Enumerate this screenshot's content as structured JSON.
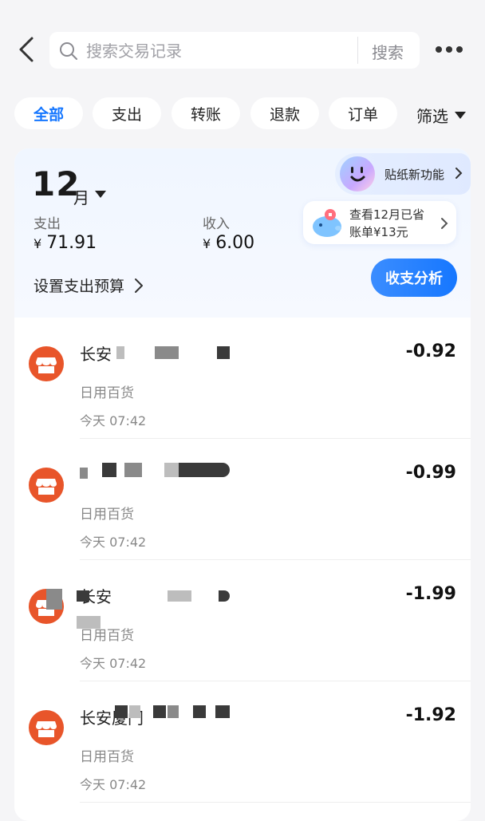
{
  "search": {
    "placeholder": "搜索交易记录",
    "button_label": "搜索"
  },
  "filters": {
    "chips": [
      "全部",
      "支出",
      "转账",
      "退款",
      "订单"
    ],
    "active": "全部",
    "dropdown_label": "筛选"
  },
  "summary": {
    "month": "12",
    "month_unit": "月",
    "expense_label": "支出",
    "expense_currency": "¥",
    "expense_value": "71.91",
    "income_label": "收入",
    "income_currency": "¥",
    "income_value": "6.00",
    "budget_label": "设置支出预算",
    "sticker_label": "贴纸新功能",
    "saved_line1": "查看12月已省",
    "saved_line2": "账单¥13元",
    "analysis_button": "收支分析"
  },
  "transactions": [
    {
      "name": "长安",
      "category": "日用百货",
      "time": "今天 07:42",
      "amount": "-0.92"
    },
    {
      "name": "",
      "category": "日用百货",
      "time": "今天 07:42",
      "amount": "-0.99"
    },
    {
      "name": "长安",
      "category": "日用百货",
      "time": "今天 07:42",
      "amount": "-1.99"
    },
    {
      "name": "长安厦门",
      "category": "日用百货",
      "time": "今天 07:42",
      "amount": "-1.92"
    }
  ],
  "colors": {
    "accent": "#1677ff",
    "merchant_icon": "#e8552a",
    "background": "#f5f5f7"
  },
  "icons": {
    "back": "chevron-left-icon",
    "search": "search-icon",
    "more": "more-icon",
    "dropdown": "caret-down-icon",
    "merchant": "store-icon",
    "sticker": "smiley-face-icon",
    "saving": "piggy-bank-icon"
  }
}
